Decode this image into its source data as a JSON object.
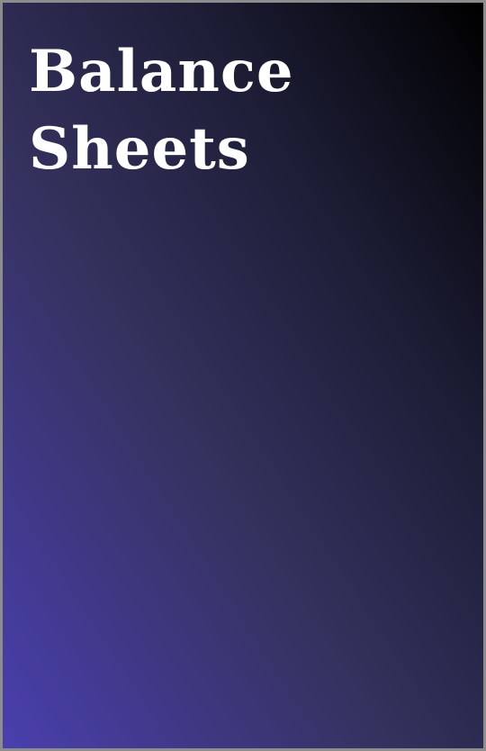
{
  "cover": {
    "title_lines": [
      "Balance",
      "Sheets"
    ],
    "colors": {
      "gradient_bottom_left": "#4a3fae",
      "gradient_mid": "#35325f",
      "gradient_top_right": "#000000",
      "title": "#ffffff",
      "border": "#8d8d8d"
    }
  }
}
